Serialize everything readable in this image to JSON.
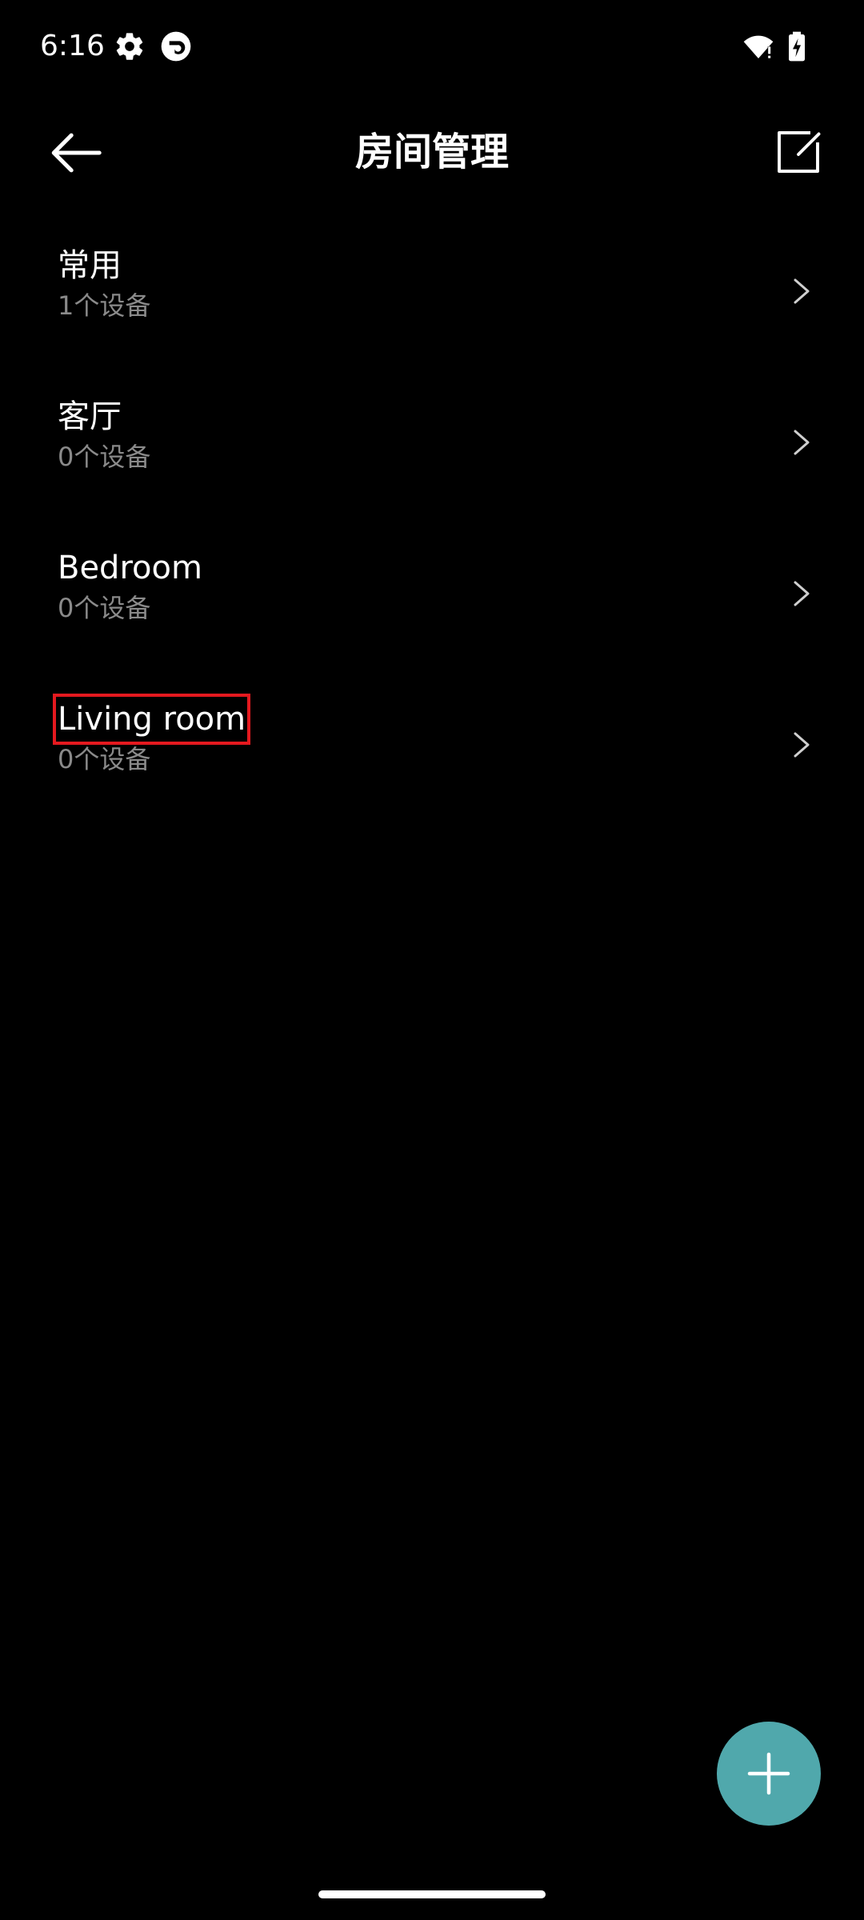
{
  "status_bar": {
    "time": "6:16",
    "icons": [
      "gear-icon",
      "app-sync-icon",
      "wifi-icon",
      "battery-charging-icon"
    ]
  },
  "header": {
    "title": "房间管理",
    "back_icon": "arrow-left-icon",
    "edit_icon": "edit-icon"
  },
  "rooms": [
    {
      "name": "常用",
      "count": "1个设备"
    },
    {
      "name": "客厅",
      "count": "0个设备"
    },
    {
      "name": "Bedroom",
      "count": "0个设备"
    },
    {
      "name": "Living room",
      "count": "0个设备",
      "highlighted": true
    }
  ],
  "fab": {
    "icon": "plus-icon"
  },
  "colors": {
    "background": "#000000",
    "text_primary": "#ffffff",
    "text_secondary": "#8a8a8a",
    "accent": "#50a8ac",
    "highlight_box": "#e5191f"
  }
}
